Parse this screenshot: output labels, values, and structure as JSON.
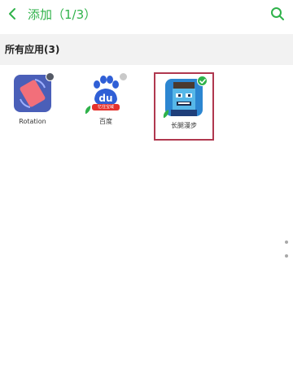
{
  "header": {
    "title": "添加（1/3）",
    "back_icon": "chevron-left-icon",
    "search_icon": "search-icon",
    "accent_color": "#2fb24a"
  },
  "section": {
    "title": "所有应用(3)"
  },
  "apps": [
    {
      "label": "Rotation",
      "icon": "rotation-app-icon",
      "selected": false
    },
    {
      "label": "百度",
      "icon": "baidu-app-icon",
      "badge": "忆住宝域",
      "selected": false
    },
    {
      "label": "长腿漫步",
      "icon": "game-app-icon",
      "selected": true
    }
  ],
  "colors": {
    "selection_border": "#b0384f",
    "check_green": "#2fb24a"
  }
}
